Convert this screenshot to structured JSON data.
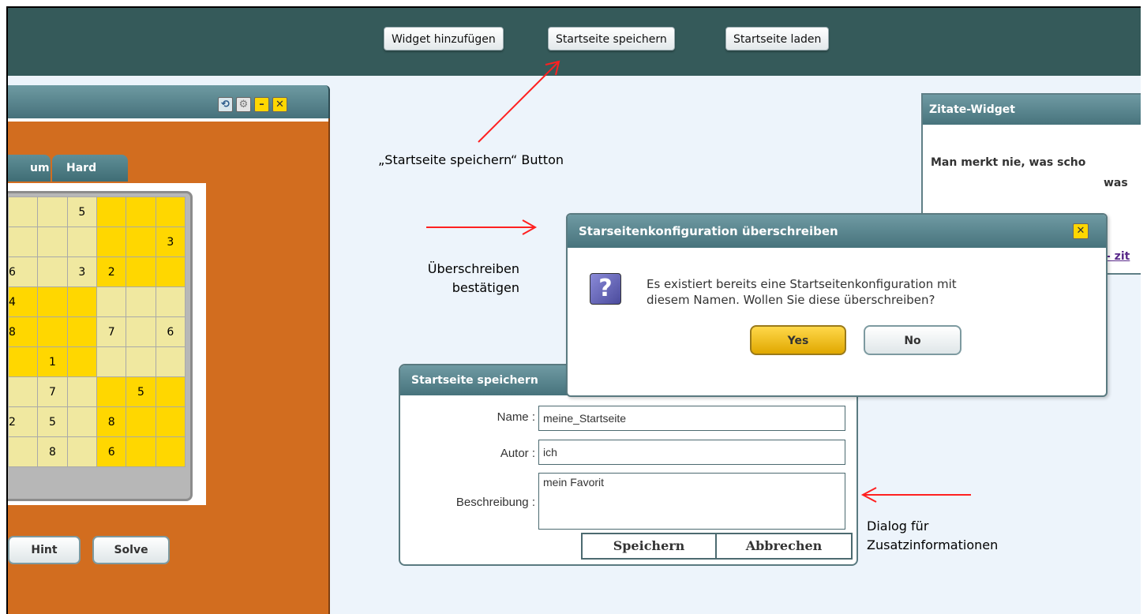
{
  "toolbar": {
    "add_widget": "Widget hinzufügen",
    "save_home": "Startseite speichern",
    "load_home": "Startseite laden"
  },
  "sudoku": {
    "tabs": [
      "um",
      "Hard"
    ],
    "cells": [
      [
        "",
        "",
        "5",
        "",
        "",
        ""
      ],
      [
        "",
        "",
        "",
        "",
        "",
        "3"
      ],
      [
        "6",
        "",
        "3",
        "2",
        "",
        ""
      ],
      [
        "4",
        "",
        "",
        "",
        "",
        ""
      ],
      [
        "8",
        "",
        "",
        "7",
        "",
        "6"
      ],
      [
        "",
        "1",
        "",
        "",
        "",
        ""
      ],
      [
        "",
        "7",
        "",
        "",
        "5",
        ""
      ],
      [
        "2",
        "5",
        "",
        "8",
        "",
        ""
      ],
      [
        "",
        "8",
        "",
        "6",
        "",
        ""
      ]
    ],
    "hint_label": "Hint",
    "solve_label": "Solve"
  },
  "annotations": {
    "save_button_note": "„Startseite speichern“ Button",
    "confirm_note_line1": "Überschreiben",
    "confirm_note_line2": "bestätigen",
    "dialog_note_line1": "Dialog für",
    "dialog_note_line2": "Zusatzinformationen"
  },
  "quote_widget": {
    "title": "Zitate-Widget",
    "text_line1": "Man merkt nie, was scho",
    "text_line2": "was",
    "link": "- zit"
  },
  "save_dialog": {
    "title": "Startseite speichern",
    "name_label": "Name :",
    "name_value": "meine_Startseite",
    "author_label": "Autor :",
    "author_value": "ich",
    "description_label": "Beschreibung :",
    "description_value": "mein Favorit",
    "save_label": "Speichern",
    "cancel_label": "Abbrechen"
  },
  "confirm_dialog": {
    "title": "Starseitenkonfiguration überschreiben",
    "message_line1": "Es existiert bereits eine Startseitenkonfiguration mit",
    "message_line2": "diesem Namen. Wollen Sie diese überschreiben?",
    "yes_label": "Yes",
    "no_label": "No"
  },
  "colors": {
    "topbar": "#355a5a",
    "widget_body": "#d26d1f",
    "cell_yellow": "#ffd700",
    "cell_light": "#f0e8a0",
    "arrow": "#ff2020"
  }
}
